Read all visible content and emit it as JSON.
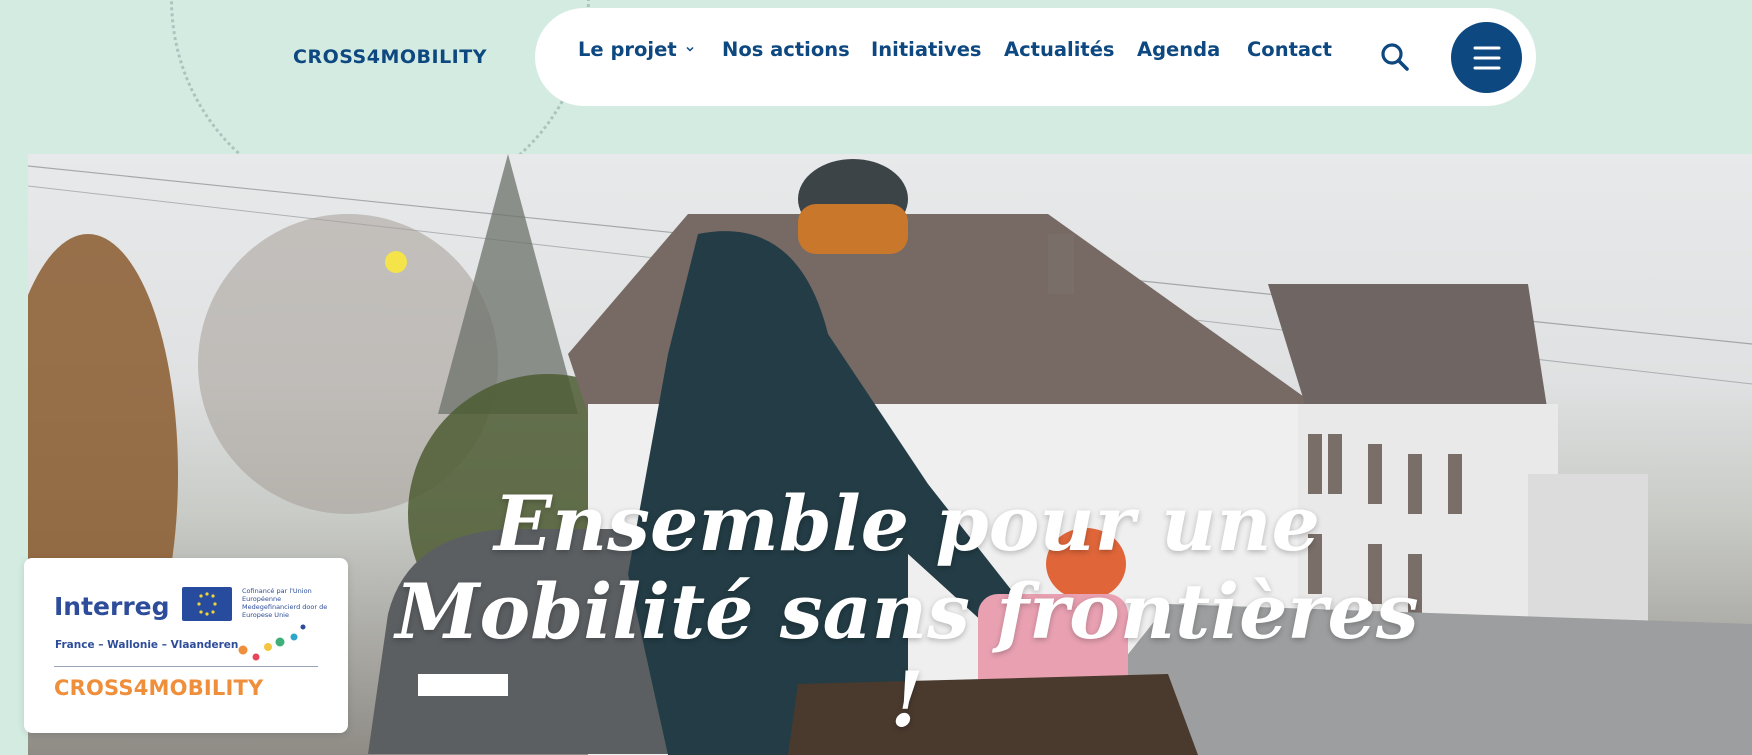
{
  "header": {
    "logo_text": "CROSS4MOBILITY",
    "nav": [
      {
        "label": "Le projet",
        "has_dropdown": true
      },
      {
        "label": "Nos actions"
      },
      {
        "label": "Initiatives"
      },
      {
        "label": "Actualités"
      },
      {
        "label": "Agenda"
      },
      {
        "label": "Contact"
      }
    ],
    "icons": {
      "search": "search-icon",
      "menu": "hamburger-menu-icon",
      "dropdown": "chevron-down-icon"
    }
  },
  "hero": {
    "title_line1": "Ensemble pour une",
    "title_line2": "Mobilité sans frontières",
    "title_line3": "!"
  },
  "partner_card": {
    "interreg": "Interreg",
    "eu_text": "Cofinancé par l'Union Européenne Medegefinancierd door de Europese Unie",
    "regions": "France – Wallonie – Vlaanderen",
    "project": "CROSS4MOBILITY"
  },
  "colors": {
    "brand_blue": "#0e4880",
    "background_mint": "#d4ebe2",
    "accent_orange": "#ef8e3b",
    "interreg_blue": "#2d4c9a"
  }
}
